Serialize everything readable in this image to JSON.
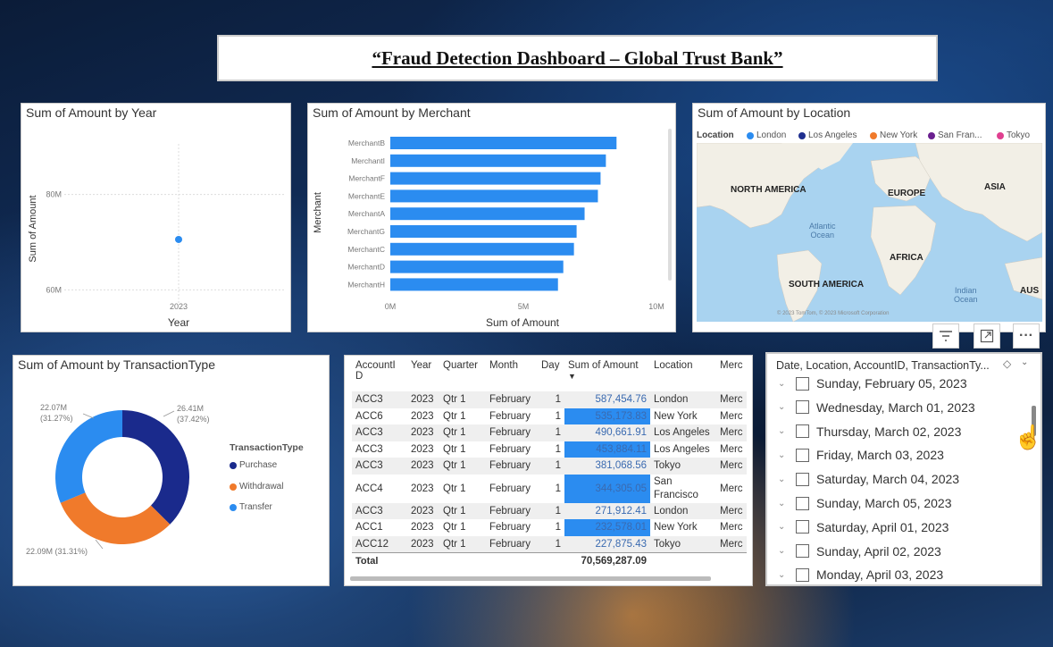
{
  "dashboard_title": "“Fraud Detection Dashboard – Global Trust Bank”",
  "year_chart": {
    "title": "Sum of Amount by Year",
    "chart_data": {
      "type": "scatter",
      "title": "Sum of Amount by Year",
      "xlabel": "Year",
      "ylabel": "Sum of Amount",
      "x": [
        "2023"
      ],
      "values": [
        70.57
      ],
      "y_ticks": [
        "80M",
        "60M"
      ],
      "ylim": [
        55,
        85
      ],
      "unit": "M"
    }
  },
  "merchant_chart": {
    "title": "Sum of Amount by Merchant",
    "chart_data": {
      "type": "bar",
      "orientation": "horizontal",
      "title": "Sum of Amount by Merchant",
      "xlabel": "Sum of Amount",
      "ylabel": "Merchant",
      "categories": [
        "MerchantB",
        "MerchantI",
        "MerchantF",
        "MerchantE",
        "MerchantA",
        "MerchantG",
        "MerchantC",
        "MerchantD",
        "MerchantH"
      ],
      "values": [
        8.5,
        8.1,
        7.9,
        7.8,
        7.3,
        7.0,
        6.9,
        6.5,
        6.3
      ],
      "x_ticks": [
        "0M",
        "5M",
        "10M"
      ],
      "xlim": [
        0,
        10
      ],
      "color": "#2b8cf0"
    }
  },
  "location_map": {
    "title": "Sum of Amount by Location",
    "legend_title": "Location",
    "legend": [
      {
        "label": "London",
        "color": "#2b8cf0"
      },
      {
        "label": "Los Angeles",
        "color": "#1f2f8f"
      },
      {
        "label": "New York",
        "color": "#f07a2b"
      },
      {
        "label": "San Fran...",
        "color": "#6a1f8f"
      },
      {
        "label": "Tokyo",
        "color": "#e04090"
      }
    ],
    "continents": {
      "na": "NORTH AMERICA",
      "eu": "EUROPE",
      "asia": "ASIA",
      "af": "AFRICA",
      "sa": "SOUTH AMERICA",
      "aus": "AUS"
    },
    "oceans": {
      "atlantic": "Atlantic\nOcean",
      "indian": "Indian\nOcean"
    },
    "attribution": "© 2023 TomTom, © 2023 Microsoft Corporation"
  },
  "toolbar": {
    "filter_icon": "filter-icon",
    "focus_icon": "focus-mode-icon",
    "more": "···"
  },
  "type_chart": {
    "title": "Sum of Amount by TransactionType",
    "legend_title": "TransactionType",
    "chart_data": {
      "type": "pie",
      "subtype": "donut",
      "title": "Sum of Amount by TransactionType",
      "categories": [
        "Purchase",
        "Withdrawal",
        "Transfer"
      ],
      "values": [
        26.41,
        22.09,
        22.07
      ],
      "percent": [
        37.42,
        31.31,
        31.27
      ],
      "colors": [
        "#1a2a8c",
        "#f07a2b",
        "#2b8cf0"
      ],
      "labels": [
        "26.41M (37.42%)",
        "22.09M (31.31%)",
        "22.07M (31.27%)"
      ]
    }
  },
  "table": {
    "columns": [
      "AccountID",
      "Year",
      "Quarter",
      "Month",
      "Day",
      "Sum of Amount",
      "Location",
      "Merc"
    ],
    "rows": [
      {
        "acc": "ACC3",
        "year": "2023",
        "q": "Qtr 1",
        "m": "February",
        "d": "1",
        "amt": "587,454.76",
        "loc": "London",
        "merc": "Merc"
      },
      {
        "acc": "ACC6",
        "year": "2023",
        "q": "Qtr 1",
        "m": "February",
        "d": "1",
        "amt": "535,173.83",
        "loc": "New York",
        "merc": "Merc"
      },
      {
        "acc": "ACC3",
        "year": "2023",
        "q": "Qtr 1",
        "m": "February",
        "d": "1",
        "amt": "490,661.91",
        "loc": "Los Angeles",
        "merc": "Merc"
      },
      {
        "acc": "ACC3",
        "year": "2023",
        "q": "Qtr 1",
        "m": "February",
        "d": "1",
        "amt": "453,884.11",
        "loc": "Los Angeles",
        "merc": "Merc"
      },
      {
        "acc": "ACC3",
        "year": "2023",
        "q": "Qtr 1",
        "m": "February",
        "d": "1",
        "amt": "381,068.56",
        "loc": "Tokyo",
        "merc": "Merc"
      },
      {
        "acc": "ACC4",
        "year": "2023",
        "q": "Qtr 1",
        "m": "February",
        "d": "1",
        "amt": "344,305.05",
        "loc": "San Francisco",
        "merc": "Merc"
      },
      {
        "acc": "ACC3",
        "year": "2023",
        "q": "Qtr 1",
        "m": "February",
        "d": "1",
        "amt": "271,912.41",
        "loc": "London",
        "merc": "Merc"
      },
      {
        "acc": "ACC1",
        "year": "2023",
        "q": "Qtr 1",
        "m": "February",
        "d": "1",
        "amt": "232,578.01",
        "loc": "New York",
        "merc": "Merc"
      },
      {
        "acc": "ACC12",
        "year": "2023",
        "q": "Qtr 1",
        "m": "February",
        "d": "1",
        "amt": "227,875.43",
        "loc": "Tokyo",
        "merc": "Merc"
      }
    ],
    "total_label": "Total",
    "total_value": "70,569,287.09"
  },
  "slicer": {
    "header": "Date, Location, AccountID, TransactionTy...",
    "items": [
      "Sunday, February 05, 2023",
      "Wednesday, March 01, 2023",
      "Thursday, March 02, 2023",
      "Friday, March 03, 2023",
      "Saturday, March 04, 2023",
      "Sunday, March 05, 2023",
      "Saturday, April 01, 2023",
      "Sunday, April 02, 2023",
      "Monday, April 03, 2023"
    ]
  }
}
